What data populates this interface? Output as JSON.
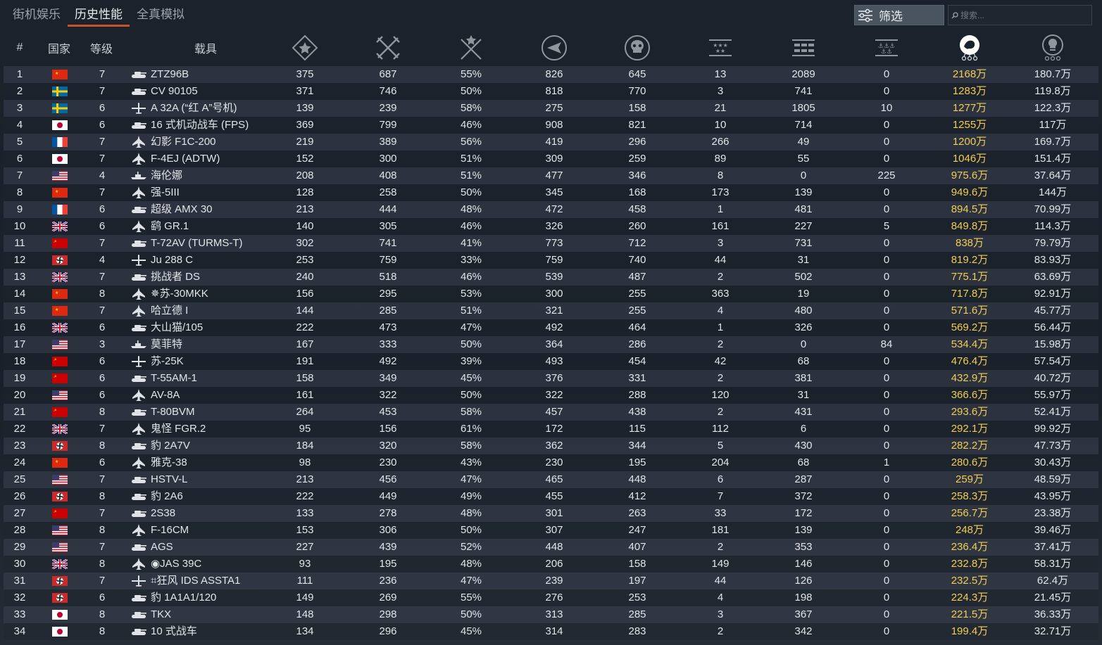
{
  "tabs": [
    "街机娱乐",
    "历史性能",
    "全真模拟"
  ],
  "filter_label": "筛选",
  "search_placeholder": "搜索...",
  "columns": {
    "rank": "#",
    "country": "国家",
    "tier": "等级",
    "vehicle": "载具"
  },
  "stat_icons": [
    "battles-icon",
    "frags-icon",
    "winrate-icon",
    "ground-kills-icon",
    "deaths-icon",
    "air-kills-icon",
    "ground-targets-icon",
    "naval-kills-icon",
    "silver-lions-icon",
    "research-points-icon"
  ],
  "colors": {
    "accent": "#c8542e",
    "gold": "#f1cd56",
    "row_odd": "#3a4250"
  },
  "rows": [
    {
      "rank": "1",
      "country": "china",
      "tier": "7",
      "type": "tank",
      "name": "ZTZ96B",
      "s1": "375",
      "s2": "687",
      "s3": "55%",
      "s4": "826",
      "s5": "645",
      "s6": "13",
      "s7": "2089",
      "s8": "0",
      "sl": "2168万",
      "rp": "180.7万"
    },
    {
      "rank": "2",
      "country": "sweden",
      "tier": "7",
      "type": "tank",
      "name": "CV 90105",
      "s1": "371",
      "s2": "746",
      "s3": "50%",
      "s4": "818",
      "s5": "770",
      "s6": "3",
      "s7": "741",
      "s8": "0",
      "sl": "1283万",
      "rp": "119.8万"
    },
    {
      "rank": "3",
      "country": "sweden",
      "tier": "6",
      "type": "plane",
      "name": "A 32A (“红 A”号机)",
      "s1": "139",
      "s2": "239",
      "s3": "58%",
      "s4": "275",
      "s5": "158",
      "s6": "21",
      "s7": "1805",
      "s8": "10",
      "sl": "1277万",
      "rp": "122.3万"
    },
    {
      "rank": "4",
      "country": "japan",
      "tier": "6",
      "type": "tank",
      "name": "16 式机动战车 (FPS)",
      "s1": "369",
      "s2": "799",
      "s3": "46%",
      "s4": "908",
      "s5": "821",
      "s6": "10",
      "s7": "714",
      "s8": "0",
      "sl": "1255万",
      "rp": "117万"
    },
    {
      "rank": "5",
      "country": "france",
      "tier": "7",
      "type": "jet",
      "name": "幻影 F1C-200",
      "s1": "219",
      "s2": "389",
      "s3": "56%",
      "s4": "419",
      "s5": "296",
      "s6": "266",
      "s7": "49",
      "s8": "0",
      "sl": "1200万",
      "rp": "169.7万"
    },
    {
      "rank": "6",
      "country": "japan",
      "tier": "7",
      "type": "jet",
      "name": "F-4EJ (ADTW)",
      "s1": "152",
      "s2": "300",
      "s3": "51%",
      "s4": "309",
      "s5": "259",
      "s6": "89",
      "s7": "55",
      "s8": "0",
      "sl": "1046万",
      "rp": "151.4万"
    },
    {
      "rank": "7",
      "country": "usa",
      "tier": "4",
      "type": "ship",
      "name": "海伦娜",
      "s1": "208",
      "s2": "408",
      "s3": "51%",
      "s4": "477",
      "s5": "346",
      "s6": "8",
      "s7": "0",
      "s8": "225",
      "sl": "975.6万",
      "rp": "37.64万"
    },
    {
      "rank": "8",
      "country": "china",
      "tier": "7",
      "type": "jet",
      "name": "强-5III",
      "s1": "128",
      "s2": "258",
      "s3": "50%",
      "s4": "345",
      "s5": "168",
      "s6": "173",
      "s7": "139",
      "s8": "0",
      "sl": "949.6万",
      "rp": "144万"
    },
    {
      "rank": "9",
      "country": "france",
      "tier": "6",
      "type": "tank",
      "name": "超级 AMX 30",
      "s1": "213",
      "s2": "444",
      "s3": "48%",
      "s4": "472",
      "s5": "458",
      "s6": "1",
      "s7": "481",
      "s8": "0",
      "sl": "894.5万",
      "rp": "70.99万"
    },
    {
      "rank": "10",
      "country": "uk",
      "tier": "6",
      "type": "jet",
      "name": "鹞 GR.1",
      "s1": "140",
      "s2": "305",
      "s3": "46%",
      "s4": "326",
      "s5": "260",
      "s6": "161",
      "s7": "227",
      "s8": "5",
      "sl": "849.8万",
      "rp": "114.3万"
    },
    {
      "rank": "11",
      "country": "ussr",
      "tier": "7",
      "type": "tank",
      "name": "T-72AV (TURMS-T)",
      "s1": "302",
      "s2": "741",
      "s3": "41%",
      "s4": "773",
      "s5": "712",
      "s6": "3",
      "s7": "731",
      "s8": "0",
      "sl": "838万",
      "rp": "79.79万"
    },
    {
      "rank": "12",
      "country": "germany",
      "tier": "4",
      "type": "plane",
      "name": "Ju 288 C",
      "s1": "253",
      "s2": "759",
      "s3": "33%",
      "s4": "759",
      "s5": "740",
      "s6": "44",
      "s7": "31",
      "s8": "0",
      "sl": "819.2万",
      "rp": "83.93万"
    },
    {
      "rank": "13",
      "country": "uk",
      "tier": "7",
      "type": "tank",
      "name": "挑战者 DS",
      "s1": "240",
      "s2": "518",
      "s3": "46%",
      "s4": "539",
      "s5": "487",
      "s6": "2",
      "s7": "502",
      "s8": "0",
      "sl": "775.1万",
      "rp": "63.69万"
    },
    {
      "rank": "14",
      "country": "china",
      "tier": "8",
      "type": "jet",
      "name": "✵苏-30MKK",
      "s1": "156",
      "s2": "295",
      "s3": "53%",
      "s4": "300",
      "s5": "255",
      "s6": "363",
      "s7": "19",
      "s8": "0",
      "sl": "717.8万",
      "rp": "92.91万"
    },
    {
      "rank": "15",
      "country": "china",
      "tier": "7",
      "type": "jet",
      "name": "哈立德 I",
      "s1": "144",
      "s2": "285",
      "s3": "51%",
      "s4": "321",
      "s5": "255",
      "s6": "4",
      "s7": "480",
      "s8": "0",
      "sl": "571.6万",
      "rp": "45.77万"
    },
    {
      "rank": "16",
      "country": "uk",
      "tier": "6",
      "type": "tank",
      "name": "大山猫/105",
      "s1": "222",
      "s2": "473",
      "s3": "47%",
      "s4": "492",
      "s5": "464",
      "s6": "1",
      "s7": "326",
      "s8": "0",
      "sl": "569.2万",
      "rp": "56.44万"
    },
    {
      "rank": "17",
      "country": "usa",
      "tier": "3",
      "type": "ship",
      "name": "莫菲特",
      "s1": "167",
      "s2": "333",
      "s3": "50%",
      "s4": "364",
      "s5": "286",
      "s6": "2",
      "s7": "0",
      "s8": "84",
      "sl": "534.4万",
      "rp": "15.98万"
    },
    {
      "rank": "18",
      "country": "ussr",
      "tier": "6",
      "type": "plane",
      "name": "苏-25K",
      "s1": "191",
      "s2": "492",
      "s3": "39%",
      "s4": "493",
      "s5": "454",
      "s6": "42",
      "s7": "68",
      "s8": "0",
      "sl": "476.4万",
      "rp": "57.54万"
    },
    {
      "rank": "19",
      "country": "ussr",
      "tier": "6",
      "type": "tank",
      "name": "T-55AM-1",
      "s1": "158",
      "s2": "349",
      "s3": "45%",
      "s4": "376",
      "s5": "331",
      "s6": "2",
      "s7": "381",
      "s8": "0",
      "sl": "432.9万",
      "rp": "40.72万"
    },
    {
      "rank": "20",
      "country": "usa",
      "tier": "6",
      "type": "jet",
      "name": "AV-8A",
      "s1": "161",
      "s2": "322",
      "s3": "50%",
      "s4": "322",
      "s5": "288",
      "s6": "120",
      "s7": "31",
      "s8": "0",
      "sl": "366.6万",
      "rp": "55.97万"
    },
    {
      "rank": "21",
      "country": "ussr",
      "tier": "8",
      "type": "tank",
      "name": "T-80BVM",
      "s1": "264",
      "s2": "453",
      "s3": "58%",
      "s4": "457",
      "s5": "438",
      "s6": "2",
      "s7": "431",
      "s8": "0",
      "sl": "293.6万",
      "rp": "52.41万"
    },
    {
      "rank": "22",
      "country": "uk",
      "tier": "7",
      "type": "jet",
      "name": "鬼怪 FGR.2",
      "s1": "95",
      "s2": "156",
      "s3": "61%",
      "s4": "172",
      "s5": "115",
      "s6": "112",
      "s7": "6",
      "s8": "0",
      "sl": "292.1万",
      "rp": "99.92万"
    },
    {
      "rank": "23",
      "country": "germany",
      "tier": "8",
      "type": "tank",
      "name": "豹 2A7V",
      "s1": "184",
      "s2": "320",
      "s3": "58%",
      "s4": "362",
      "s5": "344",
      "s6": "5",
      "s7": "430",
      "s8": "0",
      "sl": "282.2万",
      "rp": "47.73万"
    },
    {
      "rank": "24",
      "country": "china",
      "tier": "6",
      "type": "jet",
      "name": "雅克-38",
      "s1": "98",
      "s2": "230",
      "s3": "43%",
      "s4": "230",
      "s5": "195",
      "s6": "204",
      "s7": "68",
      "s8": "1",
      "sl": "280.6万",
      "rp": "30.43万"
    },
    {
      "rank": "25",
      "country": "usa",
      "tier": "7",
      "type": "tank",
      "name": "HSTV-L",
      "s1": "213",
      "s2": "456",
      "s3": "47%",
      "s4": "465",
      "s5": "448",
      "s6": "6",
      "s7": "287",
      "s8": "0",
      "sl": "259万",
      "rp": "48.59万"
    },
    {
      "rank": "26",
      "country": "germany",
      "tier": "8",
      "type": "tank",
      "name": "豹 2A6",
      "s1": "222",
      "s2": "449",
      "s3": "49%",
      "s4": "455",
      "s5": "412",
      "s6": "7",
      "s7": "372",
      "s8": "0",
      "sl": "258.3万",
      "rp": "43.95万"
    },
    {
      "rank": "27",
      "country": "ussr",
      "tier": "7",
      "type": "tank",
      "name": "2S38",
      "s1": "133",
      "s2": "278",
      "s3": "48%",
      "s4": "301",
      "s5": "263",
      "s6": "33",
      "s7": "172",
      "s8": "0",
      "sl": "256.7万",
      "rp": "23.38万"
    },
    {
      "rank": "28",
      "country": "usa",
      "tier": "8",
      "type": "jet",
      "name": "F-16CM",
      "s1": "153",
      "s2": "306",
      "s3": "50%",
      "s4": "307",
      "s5": "247",
      "s6": "181",
      "s7": "139",
      "s8": "0",
      "sl": "248万",
      "rp": "39.46万"
    },
    {
      "rank": "29",
      "country": "usa",
      "tier": "7",
      "type": "tank",
      "name": "AGS",
      "s1": "227",
      "s2": "439",
      "s3": "52%",
      "s4": "448",
      "s5": "407",
      "s6": "2",
      "s7": "353",
      "s8": "0",
      "sl": "236.4万",
      "rp": "37.41万"
    },
    {
      "rank": "30",
      "country": "uk",
      "tier": "8",
      "type": "jet",
      "name": "◉JAS 39C",
      "s1": "93",
      "s2": "195",
      "s3": "48%",
      "s4": "206",
      "s5": "158",
      "s6": "149",
      "s7": "146",
      "s8": "0",
      "sl": "232.8万",
      "rp": "58.31万"
    },
    {
      "rank": "31",
      "country": "germany",
      "tier": "7",
      "type": "plane",
      "name": "⌗狂风 IDS ASSTA1",
      "s1": "111",
      "s2": "236",
      "s3": "47%",
      "s4": "239",
      "s5": "197",
      "s6": "44",
      "s7": "126",
      "s8": "0",
      "sl": "232.5万",
      "rp": "62.4万"
    },
    {
      "rank": "32",
      "country": "germany",
      "tier": "6",
      "type": "tank",
      "name": "豹 1A1A1/120",
      "s1": "149",
      "s2": "269",
      "s3": "55%",
      "s4": "276",
      "s5": "253",
      "s6": "4",
      "s7": "198",
      "s8": "0",
      "sl": "224.3万",
      "rp": "21.45万"
    },
    {
      "rank": "33",
      "country": "japan",
      "tier": "8",
      "type": "tank",
      "name": "TKX",
      "s1": "148",
      "s2": "298",
      "s3": "50%",
      "s4": "313",
      "s5": "285",
      "s6": "3",
      "s7": "367",
      "s8": "0",
      "sl": "221.5万",
      "rp": "36.33万"
    },
    {
      "rank": "34",
      "country": "japan",
      "tier": "8",
      "type": "tank",
      "name": "10 式战车",
      "s1": "134",
      "s2": "296",
      "s3": "45%",
      "s4": "314",
      "s5": "283",
      "s6": "2",
      "s7": "342",
      "s8": "0",
      "sl": "199.4万",
      "rp": "32.71万"
    }
  ]
}
